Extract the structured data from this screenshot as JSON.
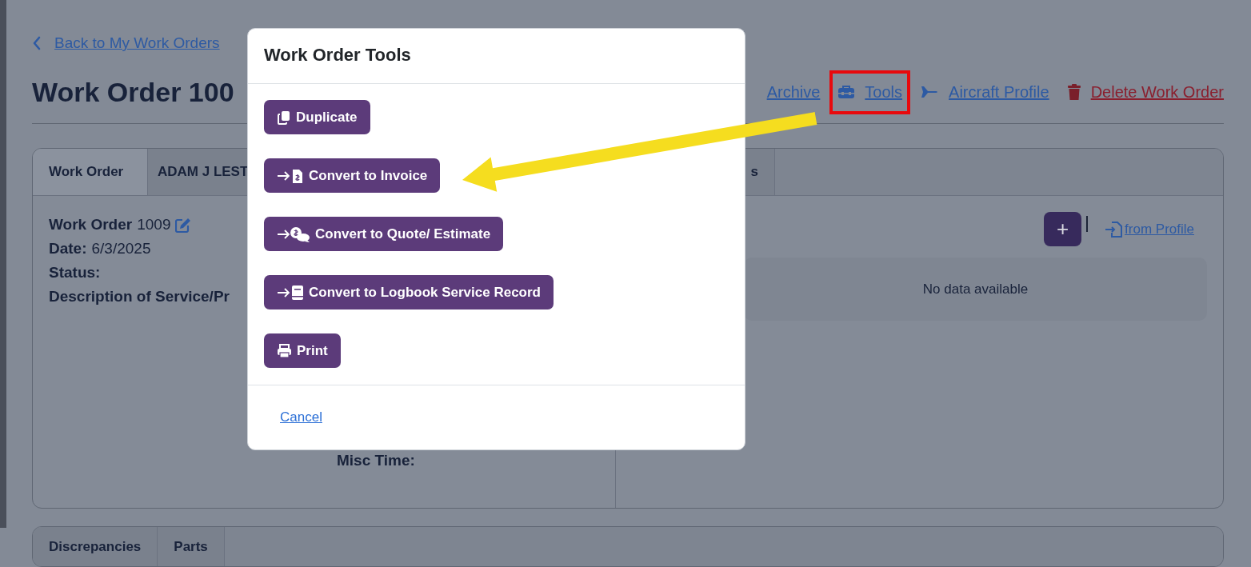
{
  "back_link": "Back to My Work Orders",
  "page_title": "Work Order 100",
  "header_actions": [
    {
      "kind": "archive",
      "label": "Archive",
      "highlighted": false
    },
    {
      "kind": "tools",
      "label": "Tools",
      "highlighted": true
    },
    {
      "kind": "aircraft",
      "label": "Aircraft Profile",
      "highlighted": false
    },
    {
      "kind": "delete",
      "label": "Delete Work Order",
      "highlighted": false
    }
  ],
  "main_tabs": [
    {
      "label": "Work Order",
      "selected": true
    },
    {
      "label": "ADAM J LEST",
      "selected": false
    },
    {
      "label": "s",
      "selected": false
    }
  ],
  "details": [
    {
      "label": "Work Order",
      "value": "1009",
      "editable": true
    },
    {
      "label": "Date:",
      "value": "6/3/2025",
      "editable": false
    },
    {
      "label": "Status:",
      "editable": false
    },
    {
      "label": "Description of Service/Pr",
      "editable": false
    }
  ],
  "misc_time_label": "Misc Time:",
  "list_panel": {
    "add_button": "+",
    "from_profile_link": "from Profile",
    "empty_message": "No data available"
  },
  "bottom_tabs": [
    {
      "label": "Discrepancies",
      "selected": false
    },
    {
      "label": "Parts",
      "selected": false
    }
  ],
  "modal": {
    "title": "Work Order Tools",
    "actions": [
      {
        "kind": "duplicate",
        "label": "Duplicate"
      },
      {
        "kind": "invoice",
        "label": "Convert to Invoice"
      },
      {
        "kind": "quote",
        "label": "Convert to Quote/ Estimate"
      },
      {
        "kind": "logbook",
        "label": "Convert to Logbook Service Record"
      },
      {
        "kind": "print",
        "label": "Print"
      }
    ],
    "cancel": "Cancel"
  }
}
